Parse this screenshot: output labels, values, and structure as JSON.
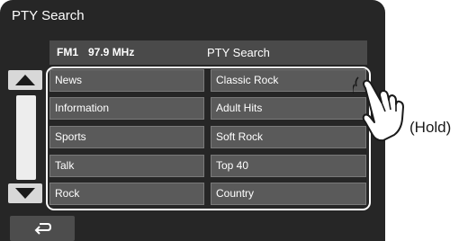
{
  "screen": {
    "title": "PTY Search",
    "station": "FM1",
    "frequency": "97.9 MHz",
    "mode_label": "PTY Search"
  },
  "pty_list": {
    "left": [
      "News",
      "Information",
      "Sports",
      "Talk",
      "Rock"
    ],
    "right": [
      "Classic Rock",
      "Adult Hits",
      "Soft Rock",
      "Top 40",
      "Country"
    ]
  },
  "icons": {
    "up": "triangle-up-icon",
    "down": "triangle-down-icon",
    "back": "return-arrow-icon",
    "hand": "pointing-hand-icon"
  },
  "annotation": {
    "hold_label": "(Hold)"
  }
}
